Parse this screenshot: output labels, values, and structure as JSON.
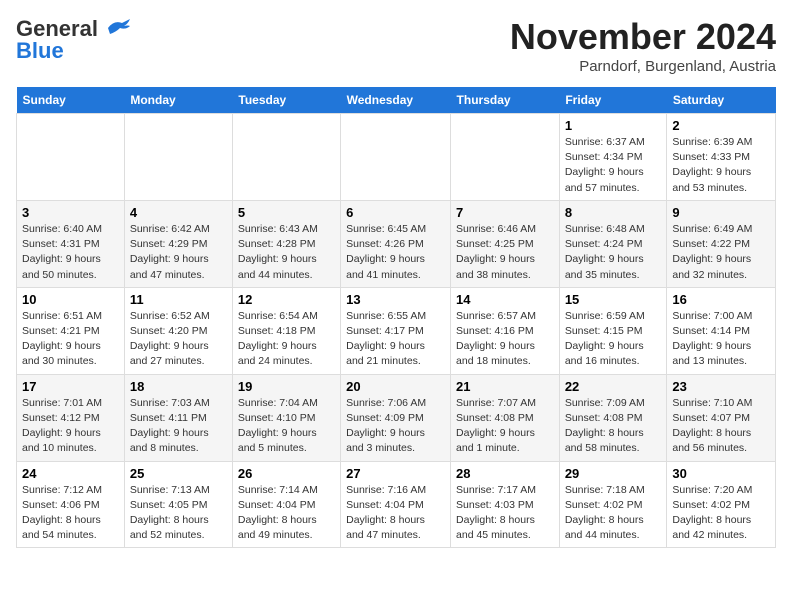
{
  "header": {
    "logo_line1": "General",
    "logo_line2": "Blue",
    "month": "November 2024",
    "location": "Parndorf, Burgenland, Austria"
  },
  "weekdays": [
    "Sunday",
    "Monday",
    "Tuesday",
    "Wednesday",
    "Thursday",
    "Friday",
    "Saturday"
  ],
  "weeks": [
    {
      "days": [
        {
          "num": "",
          "info": ""
        },
        {
          "num": "",
          "info": ""
        },
        {
          "num": "",
          "info": ""
        },
        {
          "num": "",
          "info": ""
        },
        {
          "num": "",
          "info": ""
        },
        {
          "num": "1",
          "info": "Sunrise: 6:37 AM\nSunset: 4:34 PM\nDaylight: 9 hours and 57 minutes."
        },
        {
          "num": "2",
          "info": "Sunrise: 6:39 AM\nSunset: 4:33 PM\nDaylight: 9 hours and 53 minutes."
        }
      ]
    },
    {
      "days": [
        {
          "num": "3",
          "info": "Sunrise: 6:40 AM\nSunset: 4:31 PM\nDaylight: 9 hours and 50 minutes."
        },
        {
          "num": "4",
          "info": "Sunrise: 6:42 AM\nSunset: 4:29 PM\nDaylight: 9 hours and 47 minutes."
        },
        {
          "num": "5",
          "info": "Sunrise: 6:43 AM\nSunset: 4:28 PM\nDaylight: 9 hours and 44 minutes."
        },
        {
          "num": "6",
          "info": "Sunrise: 6:45 AM\nSunset: 4:26 PM\nDaylight: 9 hours and 41 minutes."
        },
        {
          "num": "7",
          "info": "Sunrise: 6:46 AM\nSunset: 4:25 PM\nDaylight: 9 hours and 38 minutes."
        },
        {
          "num": "8",
          "info": "Sunrise: 6:48 AM\nSunset: 4:24 PM\nDaylight: 9 hours and 35 minutes."
        },
        {
          "num": "9",
          "info": "Sunrise: 6:49 AM\nSunset: 4:22 PM\nDaylight: 9 hours and 32 minutes."
        }
      ]
    },
    {
      "days": [
        {
          "num": "10",
          "info": "Sunrise: 6:51 AM\nSunset: 4:21 PM\nDaylight: 9 hours and 30 minutes."
        },
        {
          "num": "11",
          "info": "Sunrise: 6:52 AM\nSunset: 4:20 PM\nDaylight: 9 hours and 27 minutes."
        },
        {
          "num": "12",
          "info": "Sunrise: 6:54 AM\nSunset: 4:18 PM\nDaylight: 9 hours and 24 minutes."
        },
        {
          "num": "13",
          "info": "Sunrise: 6:55 AM\nSunset: 4:17 PM\nDaylight: 9 hours and 21 minutes."
        },
        {
          "num": "14",
          "info": "Sunrise: 6:57 AM\nSunset: 4:16 PM\nDaylight: 9 hours and 18 minutes."
        },
        {
          "num": "15",
          "info": "Sunrise: 6:59 AM\nSunset: 4:15 PM\nDaylight: 9 hours and 16 minutes."
        },
        {
          "num": "16",
          "info": "Sunrise: 7:00 AM\nSunset: 4:14 PM\nDaylight: 9 hours and 13 minutes."
        }
      ]
    },
    {
      "days": [
        {
          "num": "17",
          "info": "Sunrise: 7:01 AM\nSunset: 4:12 PM\nDaylight: 9 hours and 10 minutes."
        },
        {
          "num": "18",
          "info": "Sunrise: 7:03 AM\nSunset: 4:11 PM\nDaylight: 9 hours and 8 minutes."
        },
        {
          "num": "19",
          "info": "Sunrise: 7:04 AM\nSunset: 4:10 PM\nDaylight: 9 hours and 5 minutes."
        },
        {
          "num": "20",
          "info": "Sunrise: 7:06 AM\nSunset: 4:09 PM\nDaylight: 9 hours and 3 minutes."
        },
        {
          "num": "21",
          "info": "Sunrise: 7:07 AM\nSunset: 4:08 PM\nDaylight: 9 hours and 1 minute."
        },
        {
          "num": "22",
          "info": "Sunrise: 7:09 AM\nSunset: 4:08 PM\nDaylight: 8 hours and 58 minutes."
        },
        {
          "num": "23",
          "info": "Sunrise: 7:10 AM\nSunset: 4:07 PM\nDaylight: 8 hours and 56 minutes."
        }
      ]
    },
    {
      "days": [
        {
          "num": "24",
          "info": "Sunrise: 7:12 AM\nSunset: 4:06 PM\nDaylight: 8 hours and 54 minutes."
        },
        {
          "num": "25",
          "info": "Sunrise: 7:13 AM\nSunset: 4:05 PM\nDaylight: 8 hours and 52 minutes."
        },
        {
          "num": "26",
          "info": "Sunrise: 7:14 AM\nSunset: 4:04 PM\nDaylight: 8 hours and 49 minutes."
        },
        {
          "num": "27",
          "info": "Sunrise: 7:16 AM\nSunset: 4:04 PM\nDaylight: 8 hours and 47 minutes."
        },
        {
          "num": "28",
          "info": "Sunrise: 7:17 AM\nSunset: 4:03 PM\nDaylight: 8 hours and 45 minutes."
        },
        {
          "num": "29",
          "info": "Sunrise: 7:18 AM\nSunset: 4:02 PM\nDaylight: 8 hours and 44 minutes."
        },
        {
          "num": "30",
          "info": "Sunrise: 7:20 AM\nSunset: 4:02 PM\nDaylight: 8 hours and 42 minutes."
        }
      ]
    }
  ]
}
